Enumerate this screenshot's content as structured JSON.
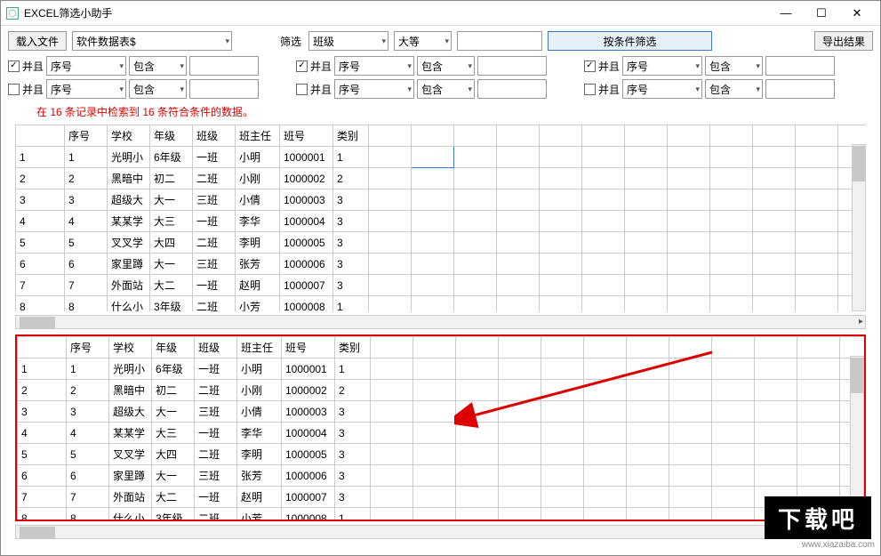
{
  "window": {
    "title": "EXCEL筛选小助手"
  },
  "toolbar": {
    "load_file": "载入文件",
    "datasource": "软件数据表$",
    "filter_lbl": "筛选",
    "filter_field": "班级",
    "compare_op": "大等",
    "apply_btn": "按条件筛选",
    "export_btn": "导出结果"
  },
  "conds": {
    "field_default": "序号",
    "op_default": "包含",
    "and_lbl": "并且"
  },
  "status": "在 16 条记录中检索到 16 条符合条件的数据。",
  "columns": [
    "序号",
    "学校",
    "年级",
    "班级",
    "班主任",
    "班号",
    "类别"
  ],
  "rows": [
    [
      "1",
      "1",
      "光明小",
      "6年级",
      "一班",
      "小明",
      "1000001",
      "1"
    ],
    [
      "2",
      "2",
      "黑暗中",
      "初二",
      "二班",
      "小刚",
      "1000002",
      "2"
    ],
    [
      "3",
      "3",
      "超级大",
      "大一",
      "三班",
      "小倩",
      "1000003",
      "3"
    ],
    [
      "4",
      "4",
      "某某学",
      "大三",
      "一班",
      "李华",
      "1000004",
      "3"
    ],
    [
      "5",
      "5",
      "叉叉学",
      "大四",
      "二班",
      "李明",
      "1000005",
      "3"
    ],
    [
      "6",
      "6",
      "家里蹲",
      "大一",
      "三班",
      "张芳",
      "1000006",
      "3"
    ],
    [
      "7",
      "7",
      "外面站",
      "大二",
      "一班",
      "赵明",
      "1000007",
      "3"
    ],
    [
      "8",
      "8",
      "什么小",
      "3年级",
      "二班",
      "小芳",
      "1000008",
      "1"
    ]
  ],
  "banner": "下载吧",
  "watermark": "www.xiazaiba.com"
}
